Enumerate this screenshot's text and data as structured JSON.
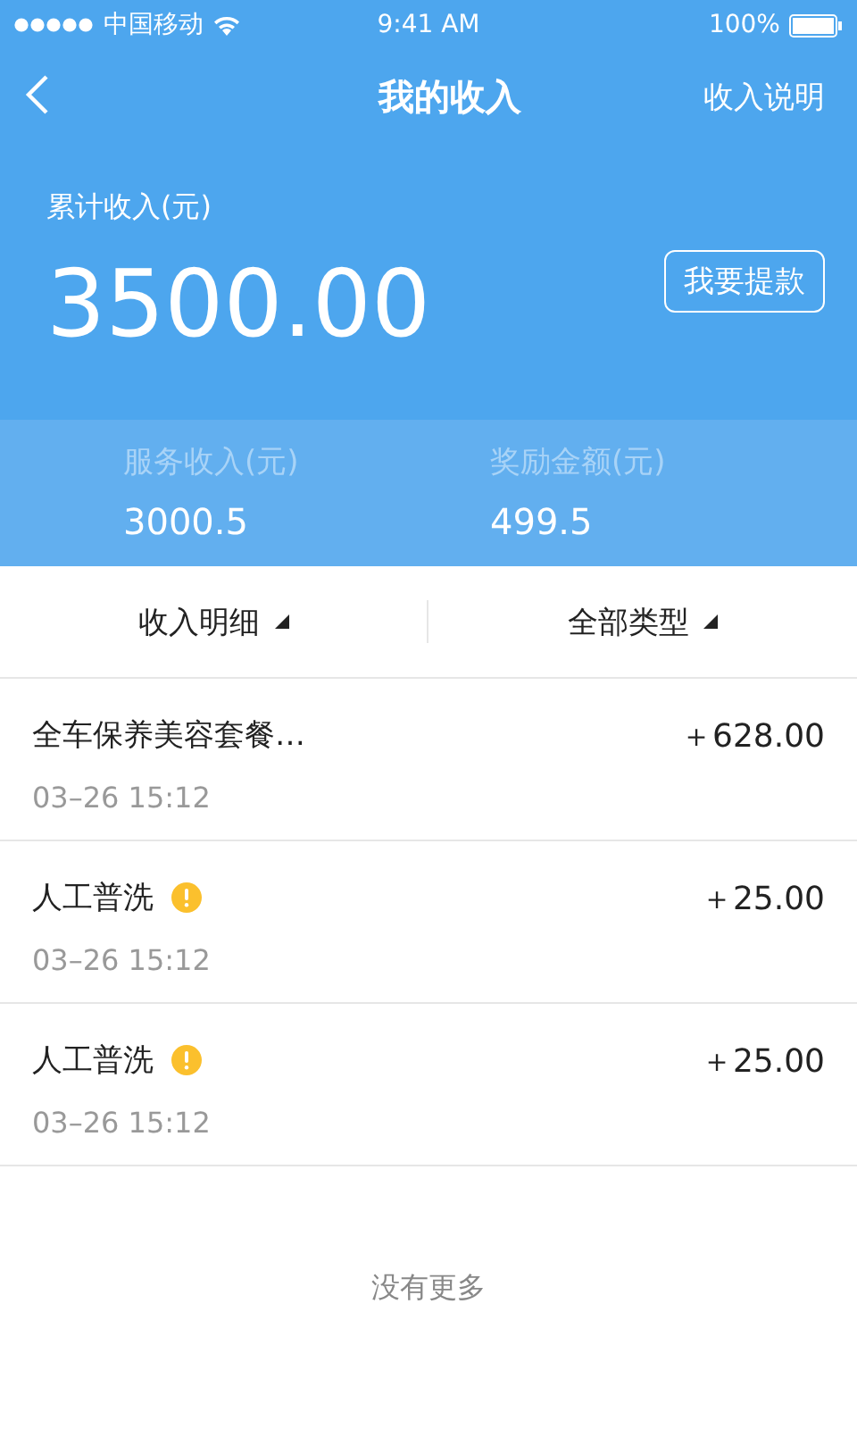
{
  "status_bar": {
    "carrier": "中国移动",
    "time": "9:41 AM",
    "battery": "100%"
  },
  "nav": {
    "title": "我的收入",
    "action": "收入说明"
  },
  "summary": {
    "label": "累计收入(元)",
    "amount": "3500.00",
    "button": "我要提款"
  },
  "stats": [
    {
      "label": "服务收入(元)",
      "value": "3000.5"
    },
    {
      "label": "奖励金额(元)",
      "value": "499.5"
    }
  ],
  "filters": [
    {
      "label": "收入明细"
    },
    {
      "label": "全部类型"
    }
  ],
  "records": [
    {
      "title": "全车保养美容套餐…",
      "time": "03–26 15:12",
      "amount": "＋628.00",
      "warning": false
    },
    {
      "title": "人工普洗",
      "time": "03–26 15:12",
      "amount": "＋25.00",
      "warning": true
    },
    {
      "title": "人工普洗",
      "time": "03–26 15:12",
      "amount": "＋25.00",
      "warning": true
    }
  ],
  "footer": "没有更多"
}
